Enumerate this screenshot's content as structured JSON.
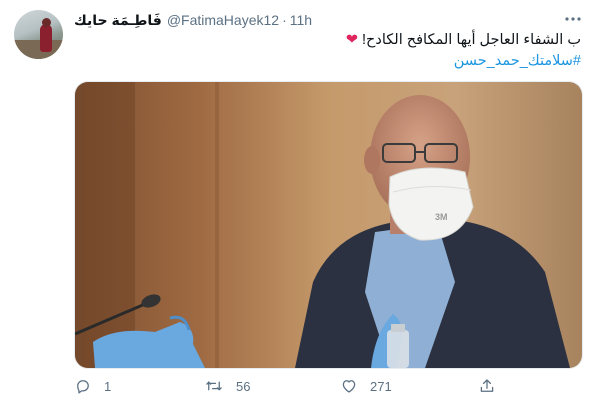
{
  "tweet": {
    "author": {
      "display_name": "فَاطِـمَة حايك",
      "handle": "@FatimaHayek12",
      "separator": "·",
      "time": "11h"
    },
    "text": {
      "line1": "ب الشفاء العاجل أيها المكافح الكادح!",
      "heart": "❤",
      "hashtag": "#سلامتك_حمد_حسن"
    },
    "media": {
      "mask_text": "3M"
    },
    "actions": {
      "reply_count": "1",
      "retweet_count": "56",
      "like_count": "271"
    },
    "icons": {
      "more": "more-horizontal-icon",
      "reply": "reply-icon",
      "retweet": "retweet-icon",
      "like": "heart-icon",
      "share": "share-icon"
    },
    "colors": {
      "link": "#1b95e0",
      "secondary_text": "#5b7083",
      "heart_emoji": "#e0245e"
    }
  }
}
